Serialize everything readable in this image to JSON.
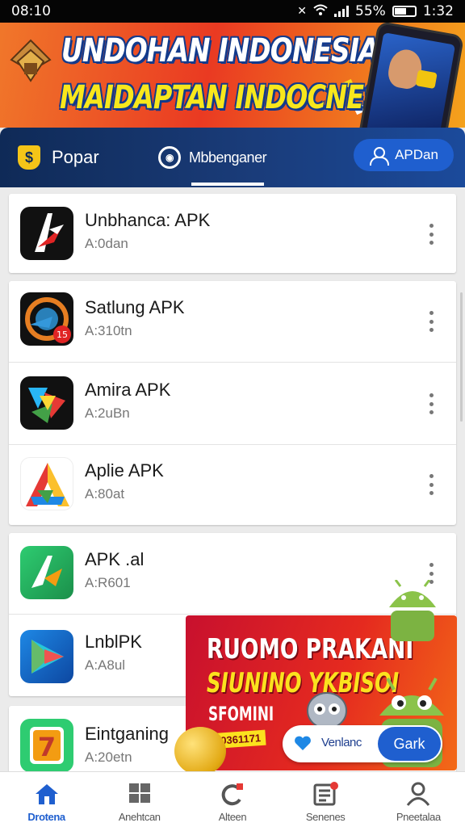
{
  "status_bar": {
    "time_left": "08:10",
    "battery_text": "55%",
    "time_right": "1:32"
  },
  "top_banner": {
    "line1": "UNDOHAN INDONESIA",
    "line2": "MAIDAPTAN INDOCNESIA"
  },
  "tabs": {
    "popular": "Popar",
    "popular_icon_glyph": "$",
    "middle": "Mbbenganer",
    "apk_button": "APDan"
  },
  "apps": [
    {
      "name": "Unbhanca: APK",
      "sub": "A:0dan",
      "icon": "red-arrow-app-icon"
    },
    {
      "name": "Satlung APK",
      "sub": "A:310tn",
      "icon": "dashboard-app-icon"
    },
    {
      "name": "Amira APK",
      "sub": "A:2uBn",
      "icon": "colorful-shapes-app-icon"
    },
    {
      "name": "Aplie APK",
      "sub": "A:80at",
      "icon": "rainbow-a-app-icon"
    },
    {
      "name": "APK .al",
      "sub": "A:R601",
      "icon": "green-arrow-app-icon"
    },
    {
      "name": "LnblPK",
      "sub": "A:A8ul",
      "icon": "play-store-app-icon"
    },
    {
      "name": "Eintganing",
      "sub": "A:20etn",
      "icon": "seven-card-app-icon"
    }
  ],
  "promo": {
    "line1": "RUOMO PRAKANI",
    "line2": "SIUNINO YKBISOI",
    "line3": "SFOMINI",
    "tag": "20361171",
    "pill_text": "Venlanc",
    "pill_button": "Gark"
  },
  "bottom_nav": [
    {
      "label": "Drotena",
      "icon": "home-icon",
      "active": true
    },
    {
      "label": "Anehtcan",
      "icon": "grid-icon",
      "active": false
    },
    {
      "label": "Alteen",
      "icon": "refresh-icon",
      "active": false
    },
    {
      "label": "Senenes",
      "icon": "news-icon",
      "active": false
    },
    {
      "label": "Pneetalaa",
      "icon": "profile-icon",
      "active": false
    }
  ],
  "colors": {
    "accent": "#1f5fcf",
    "banner_orange": "#ea3a22",
    "tab_bar_navy": "#0f2a57",
    "promo_red": "#e52a1f"
  }
}
